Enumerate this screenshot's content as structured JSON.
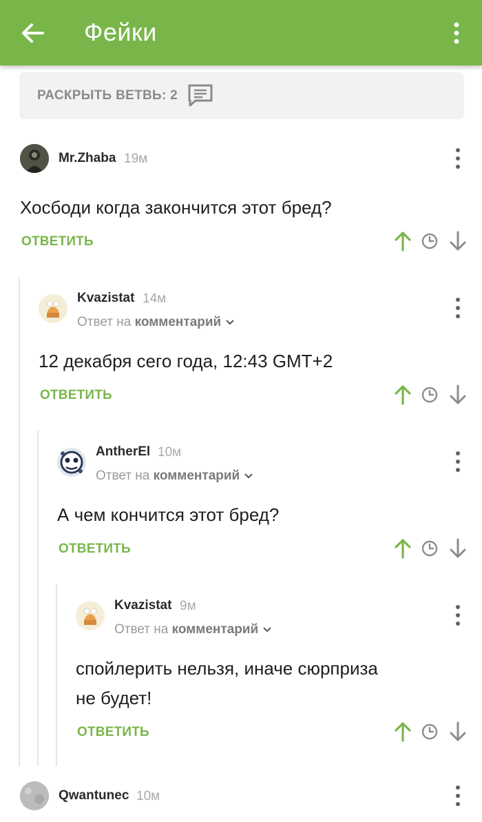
{
  "app_bar": {
    "title": "Фейки"
  },
  "expand_thread": {
    "label": "РАСКРЫТЬ ВЕТВЬ: 2"
  },
  "reply_label": "ОТВЕТИТЬ",
  "reply_to_prefix": "Ответ на",
  "reply_to_target": "комментарий",
  "comments": [
    {
      "author": "Mr.Zhaba",
      "time": "19м",
      "text": "Хосбоди когда закончится этот бред?"
    },
    {
      "author": "Kvazistat",
      "time": "14м",
      "text": "12 декабря сего года, 12:43 GMT+2"
    },
    {
      "author": "AntherEl",
      "time": "10м",
      "text": "А чем кончится этот бред?"
    },
    {
      "author": "Kvazistat",
      "time": "9м",
      "text_line1": "спойлерить нельзя, иначе сюрприза",
      "text_line2": "не будет!"
    },
    {
      "author": "Qwantunec",
      "time": "10м"
    }
  ],
  "colors": {
    "appbar": "#79b64a",
    "accent_green": "#7ab64b"
  },
  "icons": [
    "arrow-back-icon",
    "more-vert-icon",
    "comments-icon",
    "upvote-icon",
    "clock-icon",
    "downvote-icon",
    "chevron-down-icon"
  ]
}
